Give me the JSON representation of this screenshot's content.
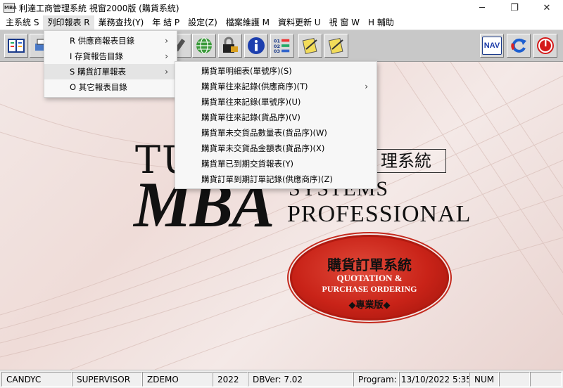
{
  "window": {
    "icon_text": "MBA",
    "title": "利達工商管理系統 視窗2000版 (購貨系統)",
    "minimize": "─",
    "maximize": "❐",
    "close": "✕"
  },
  "menubar": {
    "items": [
      {
        "label": "主系統 S"
      },
      {
        "label": "列印報表 R"
      },
      {
        "label": "業務查找(Y)"
      },
      {
        "label": "年 結 P"
      },
      {
        "label": "設定(Z)"
      },
      {
        "label": "檔案維護 M"
      },
      {
        "label": "資料更新 U"
      },
      {
        "label": "視 窗 W"
      },
      {
        "label": "H 輔助"
      }
    ]
  },
  "toolbar": {
    "left_icons": [
      "report-icon",
      "printer-icon",
      "pencil-icon",
      "globe-icon",
      "lock-icon",
      "info-icon",
      "numbered-list-icon",
      "notepad-icon",
      "notepad-edit-icon"
    ],
    "right_icons": [
      {
        "icon": "nav-icon",
        "label": "NAV"
      },
      {
        "icon": "refresh-icon"
      },
      {
        "icon": "power-icon"
      }
    ]
  },
  "report_menu": {
    "items": [
      {
        "label": "R 供應商報表目錄",
        "has_submenu": true
      },
      {
        "label": "I 存貨報告目錄",
        "has_submenu": true
      },
      {
        "label": "S 購貨訂單報表",
        "has_submenu": true
      },
      {
        "label": "O 其它報表目錄",
        "has_submenu": false
      }
    ]
  },
  "purchase_order_submenu": {
    "items": [
      {
        "label": "購貨單明細表(單號序)(S)",
        "has_submenu": false
      },
      {
        "label": "購貨單往來記錄(供應商序)(T)",
        "has_submenu": true
      },
      {
        "label": "購貨單往來記錄(單號序)(U)",
        "has_submenu": false
      },
      {
        "label": "購貨單往來記錄(貨品序)(V)",
        "has_submenu": false
      },
      {
        "label": "購貨單未交貨品數量表(貨品序)(W)",
        "has_submenu": false
      },
      {
        "label": "購貨單未交貨品金額表(貨品序)(X)",
        "has_submenu": false
      },
      {
        "label": "購貨單已到期交貨報表(Y)",
        "has_submenu": false
      },
      {
        "label": "購貨訂單到期訂單記錄(供應商序)(Z)",
        "has_submenu": false
      }
    ]
  },
  "splash": {
    "logo_tu": "TU",
    "logo_cn": "理系統",
    "logo_mba": "MBA",
    "logo_systems": "SYSTEMS",
    "logo_professional": "PROFESSIONAL",
    "badge_title": "購貨訂單系統",
    "badge_line1": "QUOTATION &",
    "badge_line2": "PURCHASE ORDERING",
    "badge_edition": "◆專業版◆"
  },
  "statusbar": {
    "user": "CANDYC",
    "role": "SUPERVISOR",
    "company": "ZDEMO",
    "year": "2022",
    "dbver": "DBVer: 7.02",
    "program_label": "Program:",
    "datetime": "13/10/2022 5:35:",
    "numlock": "NUM"
  },
  "colors": {
    "toolbar_bg": "#c8c8c8",
    "badge_red": "#c92318",
    "menu_highlight": "#e4e4e4"
  }
}
